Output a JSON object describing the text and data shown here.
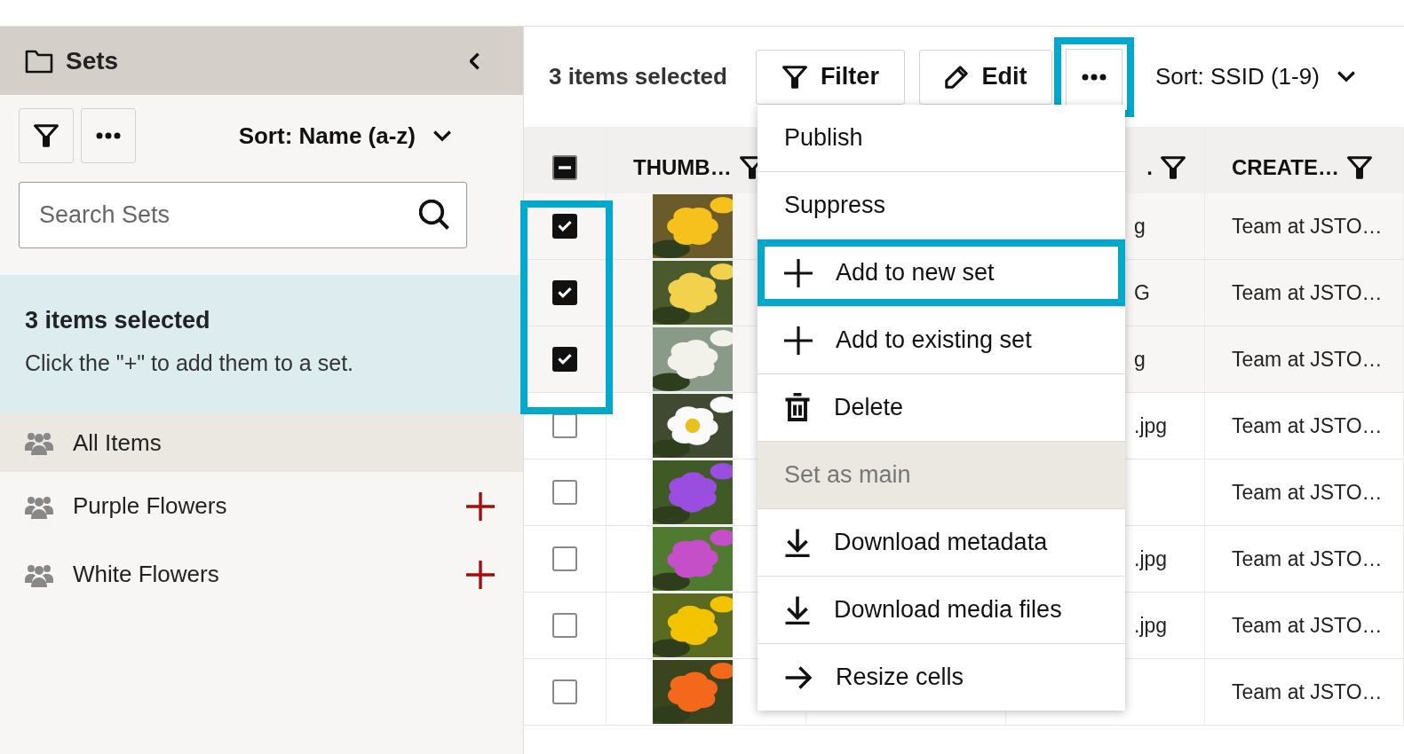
{
  "sidebar": {
    "title": "Sets",
    "sort": "Sort: Name (a-z)",
    "search": {
      "placeholder": "Search Sets"
    },
    "notice": {
      "title": "3 items selected",
      "text": "Click the \"+\" to add them to a set."
    },
    "sets": [
      {
        "name": "All Items",
        "selected": true,
        "addable": false
      },
      {
        "name": "Purple Flowers",
        "selected": false,
        "addable": true
      },
      {
        "name": "White Flowers",
        "selected": false,
        "addable": true
      }
    ]
  },
  "toolbar": {
    "selection": "3 items selected",
    "buttons": [
      {
        "kind": "filter",
        "label": "Filter",
        "highlighted": false
      },
      {
        "kind": "edit",
        "label": "Edit",
        "highlighted": false
      },
      {
        "kind": "more",
        "highlighted": true
      }
    ],
    "sort": "Sort: SSID (1-9)"
  },
  "table": {
    "header_checkbox": {
      "indeterminate": true
    },
    "columns": [
      {
        "kind": "thumbnail",
        "label": "THUMB…"
      },
      {
        "kind": "ssid"
      },
      {
        "kind": "filename",
        "label": "."
      },
      {
        "kind": "created",
        "label": "CREATE…"
      }
    ],
    "rows": [
      {
        "checked": true,
        "filename": "g",
        "created": "Team at JSTO…"
      },
      {
        "checked": true,
        "filename": "G",
        "created": "Team at JSTO…"
      },
      {
        "checked": true,
        "filename": "g",
        "created": "Team at JSTO…"
      },
      {
        "checked": false,
        "filename": ".jpg",
        "created": "Team at JSTO…"
      },
      {
        "checked": false,
        "created": "Team at JSTO…"
      },
      {
        "checked": false,
        "filename": ".jpg",
        "created": "Team at JSTO…"
      },
      {
        "checked": false,
        "filename": ".jpg",
        "created": "Team at JSTO…"
      },
      {
        "checked": false,
        "created": "Team at JSTO…"
      }
    ]
  },
  "menu": {
    "items": [
      {
        "kind": "plain",
        "label": "Publish",
        "disabled": false,
        "highlighted": false
      },
      {
        "kind": "plain",
        "label": "Suppress",
        "disabled": false,
        "highlighted": false
      },
      {
        "kind": "add",
        "label": "Add to new set",
        "disabled": false,
        "highlighted": true
      },
      {
        "kind": "add",
        "label": "Add to existing set",
        "disabled": false,
        "highlighted": false
      },
      {
        "kind": "delete",
        "label": "Delete",
        "disabled": false,
        "highlighted": false
      },
      {
        "kind": "plain",
        "label": "Set as main",
        "disabled": true,
        "highlighted": false
      },
      {
        "kind": "download",
        "label": "Download metadata",
        "disabled": false,
        "highlighted": false
      },
      {
        "kind": "download",
        "label": "Download media files",
        "disabled": false,
        "highlighted": false
      },
      {
        "kind": "arrow",
        "label": "Resize cells",
        "disabled": false,
        "highlighted": false
      }
    ]
  },
  "highlights": {
    "row_checkboxes": true
  }
}
